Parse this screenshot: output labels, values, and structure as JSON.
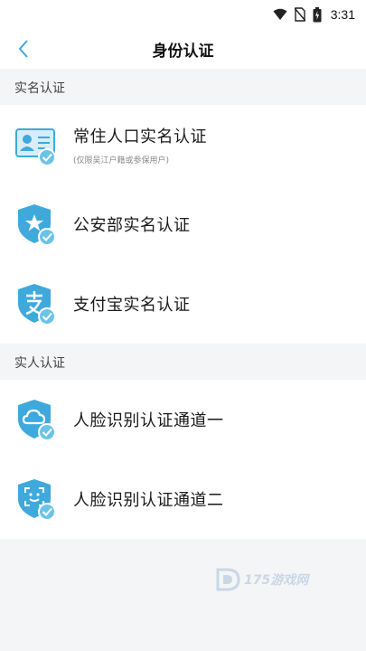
{
  "status_bar": {
    "time": "3:31",
    "icons": [
      "wifi-icon",
      "no-sim-icon",
      "battery-icon"
    ]
  },
  "nav": {
    "title": "身份认证",
    "back_icon": "chevron-left-icon"
  },
  "sections": [
    {
      "header": "实名认证",
      "items": [
        {
          "label": "常住人口实名认证",
          "sub": "(仅限吴江户籍或参保用户)",
          "icon": "id-card-icon"
        },
        {
          "label": "公安部实名认证",
          "icon": "police-shield-star-icon"
        },
        {
          "label": "支付宝实名认证",
          "icon": "alipay-shield-icon"
        }
      ]
    },
    {
      "header": "实人认证",
      "items": [
        {
          "label": "人脸识别认证通道一",
          "icon": "cloud-shield-icon"
        },
        {
          "label": "人脸识别认证通道二",
          "icon": "face-scan-shield-icon"
        }
      ]
    }
  ],
  "watermark": {
    "text": "175游戏网"
  },
  "colors": {
    "accent": "#3fa9db",
    "check": "#6cc3e8",
    "background": "#f4f5f7"
  }
}
